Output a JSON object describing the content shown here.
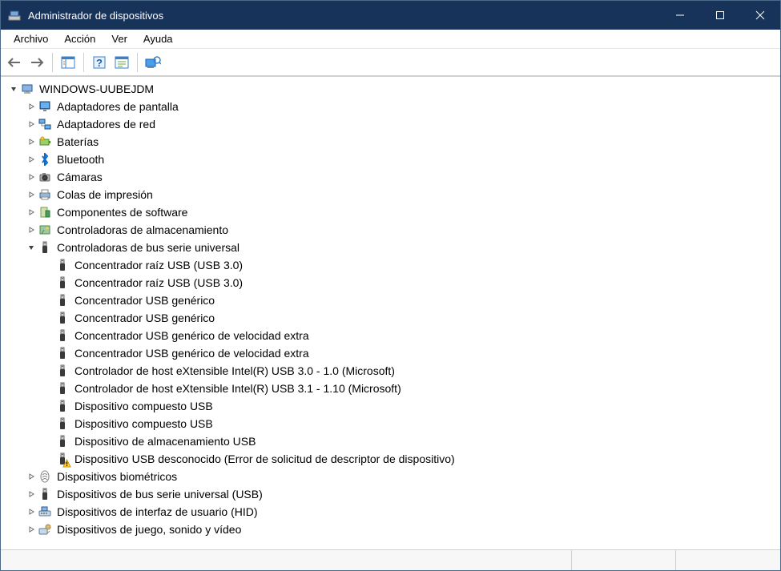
{
  "window": {
    "title": "Administrador de dispositivos"
  },
  "menu": {
    "archivo": "Archivo",
    "accion": "Acción",
    "ver": "Ver",
    "ayuda": "Ayuda"
  },
  "tree": {
    "root": "WINDOWS-UUBEJDM",
    "categories": [
      {
        "icon": "monitor",
        "label": "Adaptadores de pantalla",
        "expanded": false,
        "hasChildren": true
      },
      {
        "icon": "network",
        "label": "Adaptadores de red",
        "expanded": false,
        "hasChildren": true
      },
      {
        "icon": "battery",
        "label": "Baterías",
        "expanded": false,
        "hasChildren": true
      },
      {
        "icon": "bluetooth",
        "label": "Bluetooth",
        "expanded": false,
        "hasChildren": true
      },
      {
        "icon": "camera",
        "label": "Cámaras",
        "expanded": false,
        "hasChildren": true
      },
      {
        "icon": "printer",
        "label": "Colas de impresión",
        "expanded": false,
        "hasChildren": true
      },
      {
        "icon": "software",
        "label": "Componentes de software",
        "expanded": false,
        "hasChildren": true
      },
      {
        "icon": "storage",
        "label": "Controladoras de almacenamiento",
        "expanded": false,
        "hasChildren": true
      },
      {
        "icon": "usb",
        "label": "Controladoras de bus serie universal",
        "expanded": true,
        "hasChildren": true,
        "children": [
          {
            "icon": "usb",
            "label": "Concentrador raíz USB (USB 3.0)"
          },
          {
            "icon": "usb",
            "label": "Concentrador raíz USB (USB 3.0)"
          },
          {
            "icon": "usb",
            "label": "Concentrador USB genérico"
          },
          {
            "icon": "usb",
            "label": "Concentrador USB genérico"
          },
          {
            "icon": "usb",
            "label": "Concentrador USB genérico de velocidad extra"
          },
          {
            "icon": "usb",
            "label": "Concentrador USB genérico de velocidad extra"
          },
          {
            "icon": "usb",
            "label": "Controlador de host eXtensible Intel(R) USB 3.0 - 1.0 (Microsoft)"
          },
          {
            "icon": "usb",
            "label": "Controlador de host eXtensible Intel(R) USB 3.1 - 1.10 (Microsoft)"
          },
          {
            "icon": "usb",
            "label": "Dispositivo compuesto USB"
          },
          {
            "icon": "usb",
            "label": "Dispositivo compuesto USB"
          },
          {
            "icon": "usb",
            "label": "Dispositivo de almacenamiento USB"
          },
          {
            "icon": "usb",
            "label": "Dispositivo USB desconocido (Error de solicitud de descriptor de dispositivo)",
            "warning": true
          }
        ]
      },
      {
        "icon": "biometric",
        "label": "Dispositivos biométricos",
        "expanded": false,
        "hasChildren": true
      },
      {
        "icon": "usb",
        "label": "Dispositivos de bus serie universal (USB)",
        "expanded": false,
        "hasChildren": true
      },
      {
        "icon": "hid",
        "label": "Dispositivos de interfaz de usuario (HID)",
        "expanded": false,
        "hasChildren": true
      },
      {
        "icon": "media",
        "label": "Dispositivos de juego, sonido y vídeo",
        "expanded": false,
        "hasChildren": true
      }
    ]
  }
}
